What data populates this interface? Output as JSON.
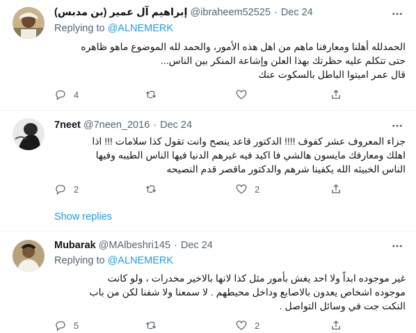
{
  "tweets": [
    {
      "name": "إبراهيم آل عمير (بن مدبس)",
      "handle": "@ibraheem52525",
      "dot": "·",
      "date": "Dec 24",
      "replying_prefix": "Replying to",
      "replying_handle": "@ALNEMERK",
      "lines": [
        "الحمدلله أهلنا ومعارفنا ماهم من اهل هذه الأمور، والحمد لله الموضوع ماهو ظاهره",
        "حتى تتكلم عليه حظرتك بهذا العلن وإشاعة المنكر بين الناس...",
        "قال عمر اميتوا الباطل بالسكوت عنك"
      ],
      "reply_count": "4",
      "retweet_count": "",
      "like_count": ""
    },
    {
      "name": "7neet",
      "handle": "@7neen_2016",
      "dot": "·",
      "date": "Dec 24",
      "lines": [
        "جزاء المعروف عشر كفوف !!!! الدكتور قاعد ينصح وانت تقول كذا سلامات !!! اذا",
        "اهلك ومعارفك مايسون هالشي فا اكيد فيه غيرهم الدنيا فيها الناس الطيبه وفيها",
        "الناس الخبيثه الله يكفينا شرهم والدكتور ماقصر قدم النصيحه"
      ],
      "reply_count": "2",
      "retweet_count": "",
      "like_count": "2",
      "show_replies": "Show replies"
    },
    {
      "name": "Mubarak",
      "handle": "@MAlbeshri145",
      "dot": "·",
      "date": "Dec 24",
      "replying_prefix": "Replying to",
      "replying_handle": "@ALNEMERK",
      "lines": [
        "غير موجوده ابداً ولا احد يغش بأمور مثل كذا لانها بالاخير مخدرات ، ولو كانت",
        "موجوده اشخاص يعدون بالاصابع وداخل محيطهم . لا سمعنا ولا شفنا لكن من باب",
        "النكت جت في وسائل التواصل ."
      ],
      "reply_count": "5",
      "retweet_count": "",
      "like_count": "2"
    }
  ],
  "icons": {
    "reply": "reply-icon",
    "retweet": "retweet-icon",
    "like": "heart-icon",
    "share": "share-icon",
    "more": "more-icon"
  },
  "colors": {
    "accent": "#1d9bf0",
    "muted": "#536471",
    "text": "#0f1419",
    "divider": "#eff3f4"
  }
}
